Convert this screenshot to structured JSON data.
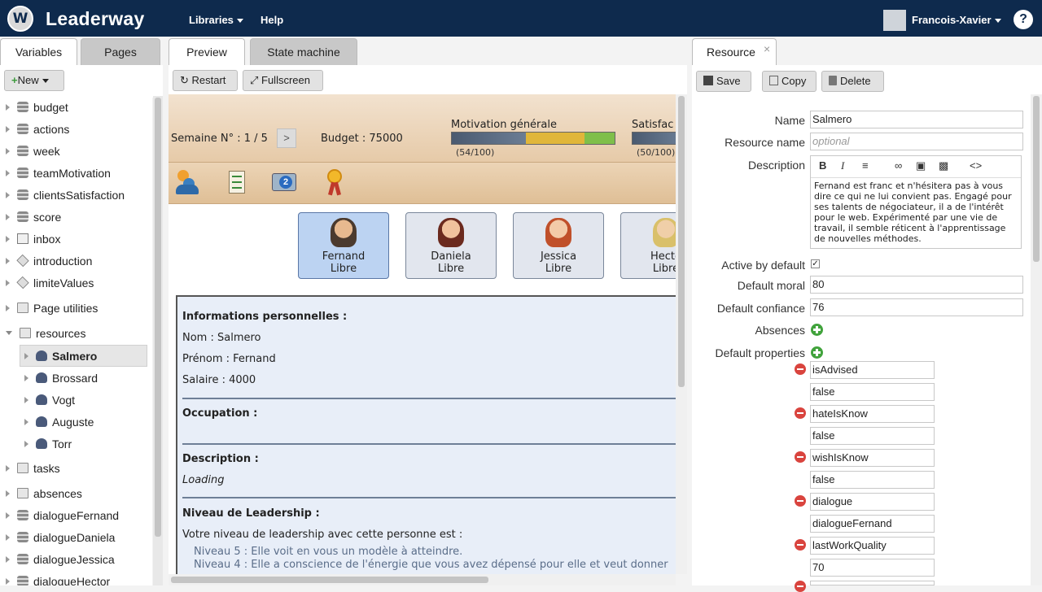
{
  "app": {
    "title": "Leaderway",
    "logo_letter": "W"
  },
  "topnav": {
    "libraries": "Libraries",
    "help": "Help",
    "user": "Francois-Xavier",
    "help_glyph": "?"
  },
  "left": {
    "tabs": [
      "Variables",
      "Pages"
    ],
    "new_label": "New",
    "tree": [
      {
        "label": "budget",
        "icon": "database-icon"
      },
      {
        "label": "actions",
        "icon": "database-icon"
      },
      {
        "label": "week",
        "icon": "database-icon"
      },
      {
        "label": "teamMotivation",
        "icon": "database-icon"
      },
      {
        "label": "clientsSatisfaction",
        "icon": "database-icon"
      },
      {
        "label": "score",
        "icon": "database-icon"
      },
      {
        "label": "inbox",
        "icon": "inbox-icon"
      },
      {
        "label": "introduction",
        "icon": "script-icon"
      },
      {
        "label": "limiteValues",
        "icon": "script-icon"
      },
      {
        "label": "Page utilities",
        "icon": "folder-icon"
      },
      {
        "label": "resources",
        "icon": "folder-icon"
      },
      {
        "label": "Salmero",
        "icon": "person-icon"
      },
      {
        "label": "Brossard",
        "icon": "person-icon"
      },
      {
        "label": "Vogt",
        "icon": "person-icon"
      },
      {
        "label": "Auguste",
        "icon": "person-icon"
      },
      {
        "label": "Torr",
        "icon": "person-icon"
      },
      {
        "label": "tasks",
        "icon": "folder-icon"
      },
      {
        "label": "absences",
        "icon": "folder-icon"
      },
      {
        "label": "dialogueFernand",
        "icon": "database-icon"
      },
      {
        "label": "dialogueDaniela",
        "icon": "database-icon"
      },
      {
        "label": "dialogueJessica",
        "icon": "database-icon"
      },
      {
        "label": "dialogueHector",
        "icon": "database-icon"
      }
    ]
  },
  "center": {
    "tabs": [
      "Preview",
      "State machine"
    ],
    "restart": "Restart",
    "fullscreen": "Fullscreen",
    "game": {
      "week": "Semaine N° : 1 / 5",
      "next": ">",
      "budget": "Budget : 75000",
      "motivation_label": "Motivation générale",
      "motivation_value": "(54/100)",
      "motivation_fraction": 0.54,
      "satisfaction_label": "Satisfac",
      "satisfaction_value": "(50/100)",
      "notification_count": "2",
      "characters": [
        {
          "name": "Fernand",
          "status": "Libre"
        },
        {
          "name": "Daniela",
          "status": "Libre"
        },
        {
          "name": "Jessica",
          "status": "Libre"
        },
        {
          "name": "Hecto",
          "status": "Libre"
        }
      ],
      "info": {
        "personal_title": "Informations personnelles :",
        "nom": "Nom : Salmero",
        "prenom": "Prénom : Fernand",
        "salaire": "Salaire : 4000",
        "occupation_title": "Occupation :",
        "description_title": "Description :",
        "loading": "Loading",
        "leadership_title": "Niveau de Leadership :",
        "leadership_text": "Votre niveau de leadership avec cette personne est :",
        "level5": "Niveau 5 : Elle voit en vous un modèle à atteindre.",
        "level4": "Niveau 4 : Elle a conscience de l'énergie que vous avez dépensé pour elle et veut donner"
      }
    }
  },
  "right": {
    "tab": "Resource",
    "close": "×",
    "save": "Save",
    "copy": "Copy",
    "delete": "Delete",
    "name_label": "Name",
    "name_value": "Salmero",
    "resource_name_label": "Resource name",
    "resource_name_placeholder": "optional",
    "description_label": "Description",
    "description_text": "Fernand est franc et n'hésitera pas à vous dire ce qui ne lui convient pas. Engagé pour ses talents de négociateur, il a de l'intérêt pour le web. Expérimenté par une vie de travail, il semble réticent à l'apprentissage de nouvelles méthodes.",
    "active_label": "Active by default",
    "active_checked": true,
    "moral_label": "Default moral",
    "moral_value": "80",
    "confiance_label": "Default confiance",
    "confiance_value": "76",
    "absences_label": "Absences",
    "properties_label": "Default properties",
    "properties": [
      {
        "key": "isAdvised",
        "value": "false"
      },
      {
        "key": "hateIsKnow",
        "value": "false"
      },
      {
        "key": "wishIsKnow",
        "value": "false"
      },
      {
        "key": "dialogue",
        "value": "dialogueFernand"
      },
      {
        "key": "lastWorkQuality",
        "value": "70"
      }
    ]
  }
}
